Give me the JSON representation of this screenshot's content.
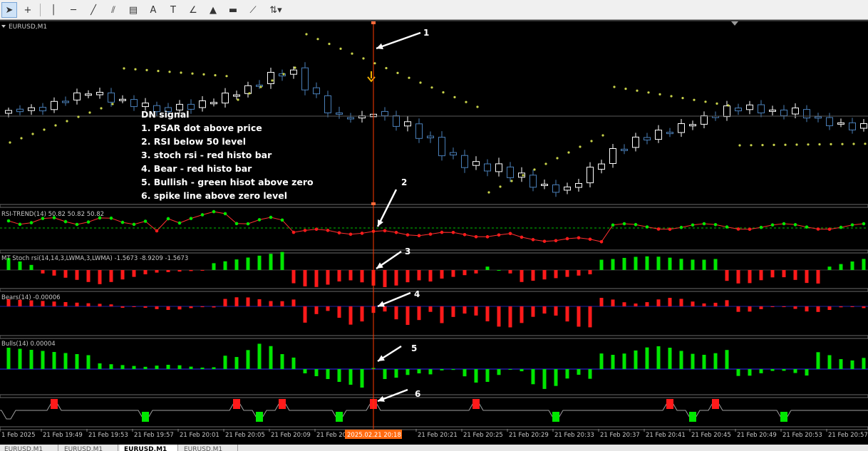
{
  "toolbar": {
    "tools": [
      {
        "name": "cursor-tool-button",
        "glyph": "➤",
        "active": true
      },
      {
        "name": "crosshair-tool-button",
        "glyph": "+",
        "active": false
      },
      {
        "name": "vertical-line-tool-button",
        "glyph": "│",
        "active": false
      },
      {
        "name": "horizontal-line-tool-button",
        "glyph": "─",
        "active": false
      },
      {
        "name": "trendline-tool-button",
        "glyph": "╱",
        "active": false
      },
      {
        "name": "equidistant-channel-tool-button",
        "glyph": "⫽",
        "active": false
      },
      {
        "name": "fibonacci-tool-button",
        "glyph": "▤",
        "active": false
      },
      {
        "name": "text-tool-button",
        "glyph": "A",
        "active": false
      },
      {
        "name": "text-label-tool-button",
        "glyph": "T",
        "active": false
      },
      {
        "name": "arrow-tool-button",
        "glyph": "∠",
        "active": false
      },
      {
        "name": "triangle-tool-button",
        "glyph": "▲",
        "active": false
      },
      {
        "name": "rectangle-tool-button",
        "glyph": "▬",
        "active": false
      },
      {
        "name": "fibo-fan-tool-button",
        "glyph": "⟋",
        "active": false
      },
      {
        "name": "arrows-dropdown-button",
        "glyph": "⇅▾",
        "active": false
      }
    ]
  },
  "chart": {
    "symbol_label": "EURUSD,M1",
    "colors": {
      "bull": "#ffffff",
      "bear": "#4a7fb8",
      "psar": "#c8d24a",
      "rsi_up": "#00e600",
      "rsi_down": "#ff1a1a",
      "level": "#00c000",
      "stoch_up": "#00e600",
      "stoch_down": "#ff1a1a",
      "bears": "#ff1a1a",
      "bulls": "#00e600",
      "signal_line": "#ff3a00",
      "grid": "#3a3a3a"
    },
    "annotation_lines": [
      "DN signal",
      "1. PSAR dot above price",
      "2. RSI below 50 level",
      "3. stoch rsi - red histo bar",
      "4. Bear - red histo bar",
      "5. Bullish - green hisot above zero",
      "6. spike line above zero level"
    ],
    "arrow_numbers": [
      "1",
      "2",
      "3",
      "4",
      "5",
      "6"
    ],
    "subwindow_labels": {
      "rsi": "RSI-TREND(14) 50.82 50.82 50.82",
      "stoch": "MT Stoch rsi(14,14,3,LWMA,3,LWMA) -1.5673 -8.9209 -1.5673",
      "bears": "Bears(14) -0.00006",
      "bulls": "Bulls(14) 0.00004"
    },
    "time_labels": [
      "1 Feb 2025",
      "21 Feb 19:49",
      "21 Feb 19:53",
      "21 Feb 19:57",
      "21 Feb 20:01",
      "21 Feb 20:05",
      "21 Feb 20:09",
      "21 Feb 20",
      "21 Feb 20:21",
      "21 Feb 20:25",
      "21 Feb 20:29",
      "21 Feb 20:33",
      "21 Feb 20:37",
      "21 Feb 20:41",
      "21 Feb 20:45",
      "21 Feb 20:49",
      "21 Feb 20:53",
      "21 Feb 20:57"
    ],
    "cursor_time_label": "2025.02.21 20:18"
  },
  "tabs": [
    {
      "label": "EURUSD,M1",
      "active": false
    },
    {
      "label": "EURUSD,M1",
      "active": false
    },
    {
      "label": "EURUSD,M1",
      "active": true
    },
    {
      "label": "EURUSD,M1",
      "active": false
    }
  ]
}
